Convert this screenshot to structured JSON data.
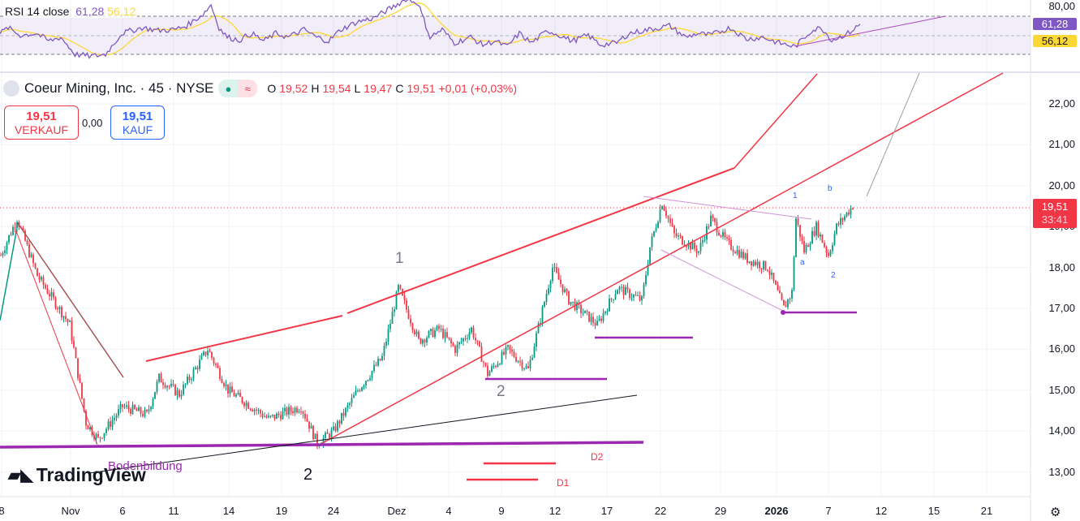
{
  "rsi": {
    "title": "RSI 14 close",
    "value": "61,28",
    "ma_value": "56,12",
    "axis_top": "80,00",
    "color": "#7e57c2",
    "ma_color": "#fdd835"
  },
  "symbol": {
    "name": "Coeur Mining, Inc. · 45 · NYSE",
    "o_label": "O",
    "o": "19,52",
    "h_label": "H",
    "h": "19,54",
    "l_label": "L",
    "l": "19,47",
    "c_label": "C",
    "c": "19,51",
    "change": "+0,01 (+0,03%)"
  },
  "trade": {
    "sell_price": "19,51",
    "sell_label": "VERKAUF",
    "spread": "0,00",
    "buy_price": "19,51",
    "buy_label": "KAUF"
  },
  "price_axis": [
    "22,00",
    "21,00",
    "20,00",
    "19,00",
    "18,00",
    "17,00",
    "16,00",
    "15,00",
    "14,00",
    "13,00"
  ],
  "last_price": {
    "price": "19,51",
    "countdown": "33:41"
  },
  "time_axis": [
    "8",
    "Nov",
    "6",
    "11",
    "14",
    "19",
    "24",
    "Dez",
    "4",
    "9",
    "12",
    "17",
    "22",
    "29",
    "2026",
    "7",
    "12",
    "15",
    "21"
  ],
  "annotations": {
    "wave1": "1",
    "wave2": "2",
    "wave2b": "2",
    "boden": "Bodenbildung",
    "d1": "D1",
    "d2": "D2",
    "s1": "1",
    "sb": "b",
    "sa": "a",
    "s2": "2"
  },
  "logo": "TradingView",
  "chart_data": {
    "type": "candlestick",
    "ylim": [
      12.6,
      22.5
    ],
    "price_keypoints": [
      [
        0,
        18.3
      ],
      [
        4,
        19.2
      ],
      [
        9,
        17.8
      ],
      [
        17,
        16.6
      ],
      [
        21,
        14.2
      ],
      [
        24,
        13.8
      ],
      [
        30,
        14.6
      ],
      [
        36,
        14.4
      ],
      [
        39,
        15.3
      ],
      [
        44,
        14.9
      ],
      [
        51,
        16.0
      ],
      [
        56,
        15.0
      ],
      [
        66,
        14.3
      ],
      [
        74,
        14.6
      ],
      [
        78,
        13.7
      ],
      [
        82,
        14.0
      ],
      [
        88,
        15.0
      ],
      [
        94,
        15.8
      ],
      [
        98,
        17.5
      ],
      [
        103,
        16.2
      ],
      [
        108,
        16.5
      ],
      [
        112,
        16.0
      ],
      [
        116,
        16.5
      ],
      [
        120,
        15.4
      ],
      [
        125,
        16.0
      ],
      [
        130,
        15.5
      ],
      [
        136,
        18.0
      ],
      [
        140,
        17.2
      ],
      [
        147,
        16.6
      ],
      [
        152,
        17.5
      ],
      [
        158,
        17.2
      ],
      [
        160,
        18.5
      ],
      [
        163,
        19.6
      ],
      [
        166,
        18.8
      ],
      [
        172,
        18.4
      ],
      [
        175,
        19.2
      ],
      [
        179,
        18.6
      ],
      [
        184,
        18.2
      ],
      [
        189,
        18.0
      ],
      [
        193,
        17.0
      ],
      [
        195,
        17.4
      ],
      [
        196,
        19.2
      ],
      [
        198,
        18.4
      ],
      [
        201,
        19.0
      ],
      [
        204,
        18.3
      ],
      [
        206,
        19.0
      ],
      [
        210,
        19.51
      ]
    ],
    "rsi_keypoints": [
      [
        0,
        52
      ],
      [
        4,
        58
      ],
      [
        10,
        50
      ],
      [
        18,
        52
      ],
      [
        24,
        44
      ],
      [
        30,
        48
      ],
      [
        37,
        30
      ],
      [
        45,
        28
      ],
      [
        52,
        30
      ],
      [
        60,
        52
      ],
      [
        70,
        58
      ],
      [
        78,
        55
      ],
      [
        86,
        56
      ],
      [
        92,
        60
      ],
      [
        100,
        72
      ],
      [
        104,
        82
      ],
      [
        108,
        58
      ],
      [
        112,
        48
      ],
      [
        118,
        45
      ],
      [
        124,
        52
      ],
      [
        130,
        44
      ],
      [
        136,
        52
      ],
      [
        142,
        48
      ],
      [
        150,
        56
      ],
      [
        156,
        48
      ],
      [
        162,
        44
      ],
      [
        168,
        56
      ],
      [
        176,
        64
      ],
      [
        184,
        68
      ],
      [
        194,
        80
      ],
      [
        200,
        88
      ],
      [
        206,
        84
      ],
      [
        212,
        48
      ],
      [
        218,
        56
      ],
      [
        224,
        42
      ],
      [
        232,
        48
      ],
      [
        238,
        40
      ],
      [
        244,
        44
      ],
      [
        250,
        38
      ],
      [
        256,
        52
      ],
      [
        262,
        42
      ],
      [
        270,
        55
      ],
      [
        276,
        50
      ],
      [
        282,
        44
      ],
      [
        290,
        50
      ],
      [
        296,
        40
      ],
      [
        304,
        42
      ],
      [
        310,
        52
      ],
      [
        320,
        56
      ],
      [
        330,
        60
      ],
      [
        338,
        48
      ],
      [
        344,
        52
      ],
      [
        350,
        50
      ],
      [
        360,
        58
      ],
      [
        368,
        46
      ],
      [
        376,
        48
      ],
      [
        384,
        42
      ],
      [
        392,
        38
      ],
      [
        400,
        55
      ],
      [
        405,
        58
      ],
      [
        410,
        45
      ],
      [
        418,
        52
      ],
      [
        424,
        61.28
      ]
    ]
  }
}
